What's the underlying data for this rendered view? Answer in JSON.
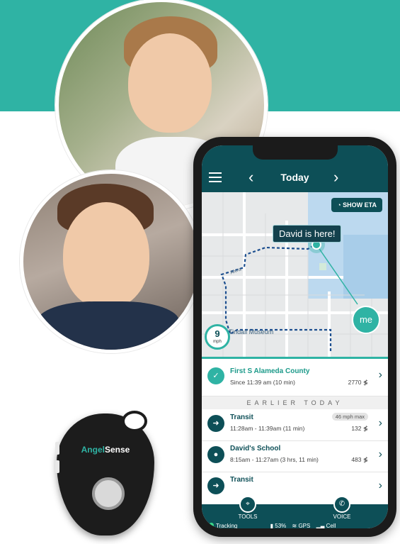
{
  "colors": {
    "accent": "#2fb3a4",
    "dark": "#0d4f57"
  },
  "app": {
    "date_label": "Today",
    "show_eta_label": "SHOW ETA",
    "location_bubble": "David is here!",
    "me_label": "me",
    "speed_value": "9",
    "speed_unit": "mph",
    "map_place": "Tindall Museum",
    "map_road": "Alvra"
  },
  "list": {
    "current": {
      "title": "First S Alameda County",
      "subtitle": "Since 11:39 am (10 min)",
      "meta": "2770 ≸"
    },
    "earlier_header": "EARLIER TODAY",
    "items": [
      {
        "title": "Transit",
        "badge": "46 mph max",
        "subtitle": "11:28am - 11:39am (11 min)",
        "meta": "132 ≸"
      },
      {
        "title": "David's School",
        "subtitle": "8:15am - 11:27am (3 hrs, 11 min)",
        "meta": "483 ≸"
      },
      {
        "title": "Transit",
        "subtitle": "",
        "meta": ""
      }
    ]
  },
  "bottom": {
    "tools_label": "TOOLS",
    "voice_label": "VOICE",
    "tracking_label": "Tracking",
    "battery_label": "53%",
    "gps_label": "GPS",
    "cell_label": "Cell"
  },
  "device": {
    "brand_prefix": "Angel",
    "brand_suffix": "Sense"
  }
}
